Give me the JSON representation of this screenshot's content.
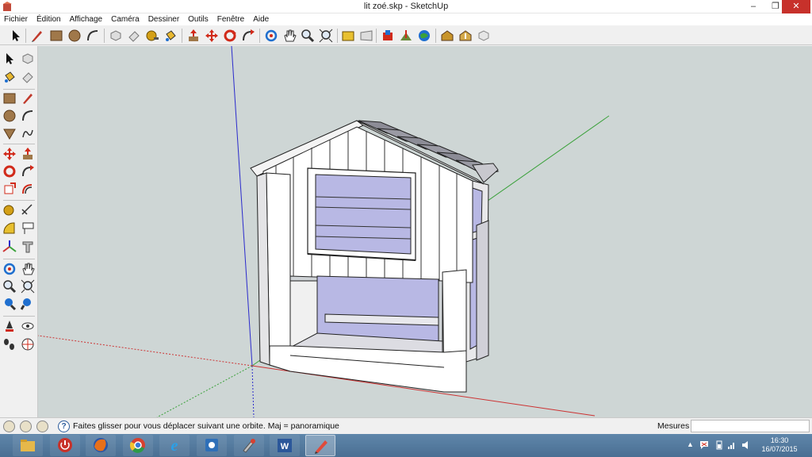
{
  "window": {
    "title": "lit zoé.skp - SketchUp",
    "min_glyph": "‒",
    "max_glyph": "❐",
    "close_glyph": "✕"
  },
  "menu": [
    "Fichier",
    "Édition",
    "Affichage",
    "Caméra",
    "Dessiner",
    "Outils",
    "Fenêtre",
    "Aide"
  ],
  "top_toolbar": {
    "tools": [
      {
        "name": "select-tool-icon"
      },
      {
        "name": "pencil-tool-icon"
      },
      {
        "name": "rectangle-tool-icon"
      },
      {
        "name": "circle-tool-icon"
      },
      {
        "name": "arc-tool-icon"
      },
      {
        "name": "make-component-icon"
      },
      {
        "name": "eraser-tool-icon"
      },
      {
        "name": "tape-measure-icon"
      },
      {
        "name": "paint-bucket-icon"
      },
      {
        "name": "push-pull-icon"
      },
      {
        "name": "move-tool-icon"
      },
      {
        "name": "rotate-tool-icon"
      },
      {
        "name": "follow-me-icon"
      },
      {
        "name": "orbit-tool-icon"
      },
      {
        "name": "pan-tool-icon"
      },
      {
        "name": "zoom-tool-icon"
      },
      {
        "name": "zoom-extents-icon"
      },
      {
        "name": "previous-view-icon"
      },
      {
        "name": "next-view-icon"
      },
      {
        "name": "add-location-icon"
      },
      {
        "name": "terrain-icon"
      },
      {
        "name": "google-earth-icon"
      },
      {
        "name": "warehouse-get-models-icon"
      },
      {
        "name": "warehouse-share-model-icon"
      },
      {
        "name": "share-component-icon"
      }
    ]
  },
  "status": {
    "hint": "Faites glisser pour vous déplacer suivant une orbite.  Maj = panoramique",
    "help_glyph": "?",
    "measures_label": "Mesures",
    "measures_value": ""
  },
  "taskbar": {
    "apps": [
      {
        "name": "file-explorer-icon"
      },
      {
        "name": "power-icon"
      },
      {
        "name": "firefox-icon"
      },
      {
        "name": "chrome-icon"
      },
      {
        "name": "internet-explorer-icon"
      },
      {
        "name": "app-settings-icon"
      },
      {
        "name": "tool-app-icon"
      },
      {
        "name": "word-icon"
      },
      {
        "name": "sketchup-icon"
      }
    ],
    "time": "16:30",
    "date": "16/07/2015"
  },
  "colors": {
    "viewport_bg": "#ced6d5",
    "wood": "#ffffff",
    "glass": "#b8b8e4",
    "axis_red": "#cc3333",
    "axis_green": "#3aa13a",
    "axis_blue": "#2a2acc",
    "taskbar": "#5579a0"
  }
}
